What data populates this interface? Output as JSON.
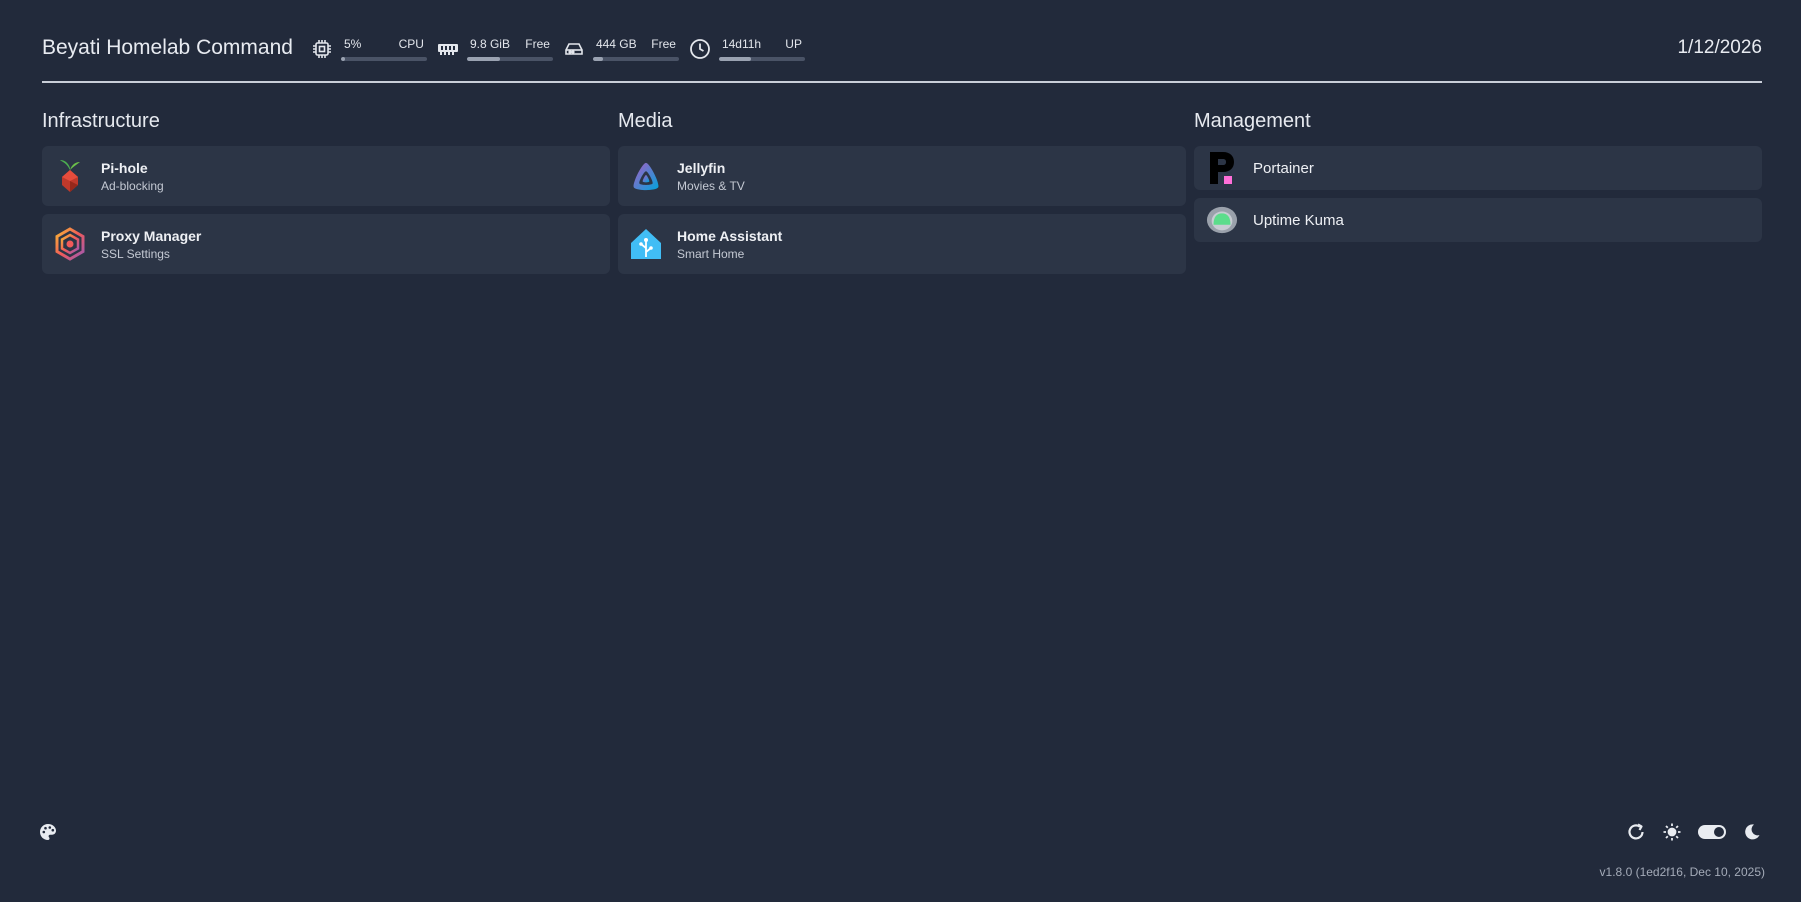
{
  "header": {
    "title": "Beyati Homelab Command",
    "date": "1/12/2026",
    "widgets": [
      {
        "icon": "cpu-icon",
        "value": "5%",
        "label": "CPU",
        "percent": 5
      },
      {
        "icon": "memory-icon",
        "value": "9.8 GiB",
        "label": "Free",
        "percent": 38
      },
      {
        "icon": "disk-icon",
        "value": "444 GB",
        "label": "Free",
        "percent": 12
      },
      {
        "icon": "clock-icon",
        "value": "14d11h",
        "label": "UP",
        "percent": 37
      }
    ]
  },
  "groups": [
    {
      "title": "Infrastructure",
      "services": [
        {
          "name": "Pi-hole",
          "description": "Ad-blocking",
          "icon": "pihole-icon"
        },
        {
          "name": "Proxy Manager",
          "description": "SSL Settings",
          "icon": "proxy-manager-icon"
        }
      ]
    },
    {
      "title": "Media",
      "services": [
        {
          "name": "Jellyfin",
          "description": "Movies & TV",
          "icon": "jellyfin-icon"
        },
        {
          "name": "Home Assistant",
          "description": "Smart Home",
          "icon": "home-assistant-icon"
        }
      ]
    },
    {
      "title": "Management",
      "services": [
        {
          "name": "Portainer",
          "icon": "portainer-icon"
        },
        {
          "name": "Uptime Kuma",
          "icon": "uptime-kuma-icon"
        }
      ]
    }
  ],
  "footer": {
    "version": "v1.8.0 (1ed2f16, Dec 10, 2025)"
  },
  "colors": {
    "background": "#222a3b",
    "tile": "#2c3546",
    "text": "#e6e9ef"
  }
}
